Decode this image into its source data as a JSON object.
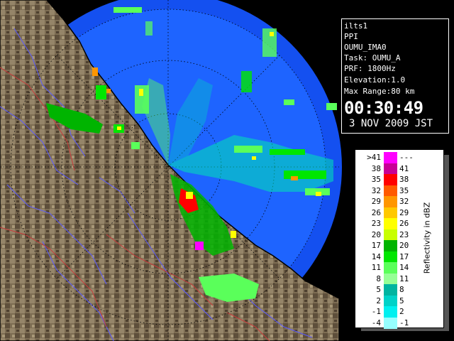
{
  "info": {
    "radar": "ilts1",
    "scan_type": "PPI",
    "file": "OUMU_IMA0",
    "task": "Task: OUMU_A",
    "prf": "PRF: 1800Hz",
    "elevation": "Elevation:1.0",
    "max_range": "Max Range:80 km",
    "time": "00:30:49",
    "date": "3 NOV 2009 JST"
  },
  "legend": {
    "title": "Reflectivity in dBZ",
    "rows": [
      {
        "low": ">41",
        "high": "---",
        "color": "#ff00ff"
      },
      {
        "low": "38",
        "high": "41",
        "color": "#c80096"
      },
      {
        "low": "35",
        "high": "38",
        "color": "#ff0000"
      },
      {
        "low": "32",
        "high": "35",
        "color": "#ff5a00"
      },
      {
        "low": "29",
        "high": "32",
        "color": "#ff9600"
      },
      {
        "low": "26",
        "high": "29",
        "color": "#ffc800"
      },
      {
        "low": "23",
        "high": "26",
        "color": "#ffff00"
      },
      {
        "low": "20",
        "high": "23",
        "color": "#c8ff00"
      },
      {
        "low": "17",
        "high": "20",
        "color": "#00b400"
      },
      {
        "low": "14",
        "high": "17",
        "color": "#00e600"
      },
      {
        "low": "11",
        "high": "14",
        "color": "#5aff5a"
      },
      {
        "low": "8",
        "high": "11",
        "color": "#96ff96"
      },
      {
        "low": "5",
        "high": "8",
        "color": "#00b4a0"
      },
      {
        "low": "2",
        "high": "5",
        "color": "#00d2c8"
      },
      {
        "low": "-1",
        "high": "2",
        "color": "#00f0f0"
      },
      {
        "low": "-4",
        "high": "-1",
        "color": "#96ffff"
      }
    ]
  },
  "colors": {
    "sea": "#1e64ff",
    "sea_outer": "#1450f0",
    "land": "#82735a",
    "land_dark": "#5a4b37",
    "coast": "#000000",
    "river": "#5a5aff",
    "border": "#c83c3c"
  }
}
